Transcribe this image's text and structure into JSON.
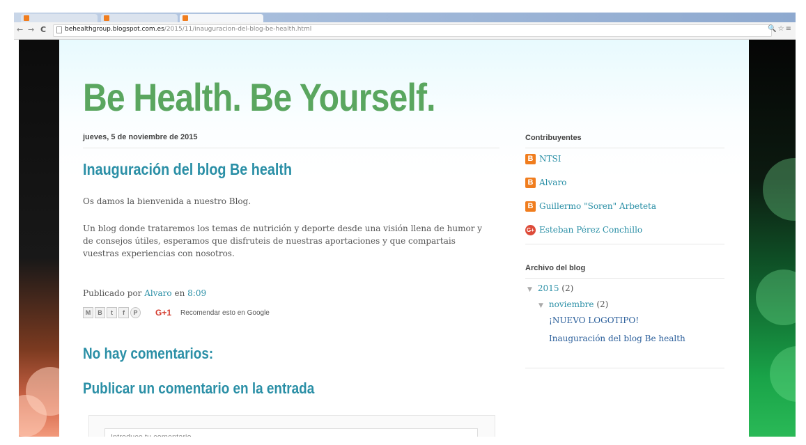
{
  "browser": {
    "url_host": "behealthgroup.blogspot.com.es",
    "url_path": "/2015/11/inauguracion-del-blog-be-health.html",
    "nav_back": "←",
    "nav_forward": "→",
    "nav_reload": "C",
    "tool_icons": "🔍☆≡"
  },
  "blog": {
    "title": "Be Health. Be Yourself."
  },
  "post": {
    "date": "jueves, 5 de noviembre de 2015",
    "title": "Inauguración del blog Be health",
    "paragraph1": "Os damos la bienvenida a nuestro Blog.",
    "paragraph2": "Un blog donde trataremos los temas de nutrición y deporte desde una visión llena de humor y de consejos útiles, esperamos que disfruteis de nuestras aportaciones y que compartais vuestras experiencias con nosotros.",
    "published_by_label": "Publicado por",
    "author": "Alvaro",
    "on_label": "en",
    "time": "8:09",
    "share": {
      "email": "M",
      "blog": "B",
      "twitter": "t",
      "facebook": "f",
      "pinterest": "P",
      "gplus": "G+1",
      "recommend": "Recomendar esto en Google"
    }
  },
  "comments": {
    "no_comments": "No hay comentarios:",
    "post_comment": "Publicar un comentario en la entrada",
    "input_placeholder": "Introduce tu comentario..."
  },
  "sidebar": {
    "contributors_title": "Contribuyentes",
    "contributors": [
      {
        "name": "NTSI",
        "icon": "blogger-icon"
      },
      {
        "name": "Alvaro",
        "icon": "blogger-icon"
      },
      {
        "name": "Guillermo \"Soren\" Arbeteta",
        "icon": "blogger-icon"
      },
      {
        "name": "Esteban Pérez Conchillo",
        "icon": "google-plus-icon"
      }
    ],
    "archive_title": "Archivo del blog",
    "archive": {
      "year": "2015",
      "year_count": "(2)",
      "month": "noviembre",
      "month_count": "(2)",
      "posts": [
        "¡NUEVO LOGOTIPO!",
        "Inauguración del blog Be health"
      ]
    }
  },
  "colors": {
    "title_green": "#5aa65f",
    "link_teal": "#2a8fa6",
    "blogger_orange": "#f07d1e",
    "gplus_red": "#dd4b39"
  }
}
